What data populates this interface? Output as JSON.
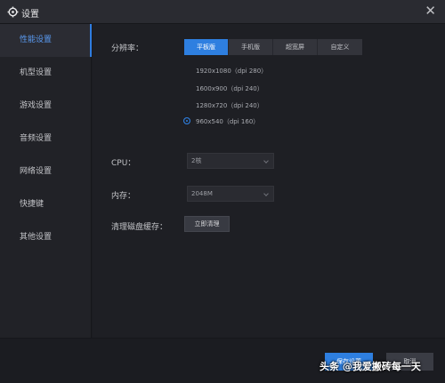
{
  "window": {
    "title": "设置",
    "close_glyph": "✕"
  },
  "sidebar": {
    "items": [
      {
        "label": "性能设置",
        "active": true
      },
      {
        "label": "机型设置"
      },
      {
        "label": "游戏设置"
      },
      {
        "label": "音频设置"
      },
      {
        "label": "网络设置"
      },
      {
        "label": "快捷键"
      },
      {
        "label": "其他设置"
      }
    ]
  },
  "resolution": {
    "label": "分辨率：",
    "modes": [
      "平板版",
      "手机版",
      "超宽屏",
      "自定义"
    ],
    "active_mode": "平板版",
    "options": [
      "1920x1080（dpi 280）",
      "1600x900（dpi 240）",
      "1280x720（dpi 240）",
      "960x540（dpi 160）"
    ],
    "selected_option": "960x540（dpi 160）"
  },
  "cpu": {
    "label": "CPU：",
    "value": "2核"
  },
  "memory": {
    "label": "内存：",
    "value": "2048M"
  },
  "cache": {
    "label": "清理磁盘缓存：",
    "button": "立即清理"
  },
  "footer": {
    "save_label": "保存设置",
    "cancel_label": "取消"
  },
  "watermark": {
    "text": "头条 @我爱搬砖每一天"
  },
  "colors": {
    "accent": "#2e7fe0",
    "background": "#1e1f24",
    "sidebar": "#212227"
  },
  "icons": {
    "title": "gear-icon",
    "close": "close-icon",
    "dropdown": "chevron-down-icon"
  }
}
